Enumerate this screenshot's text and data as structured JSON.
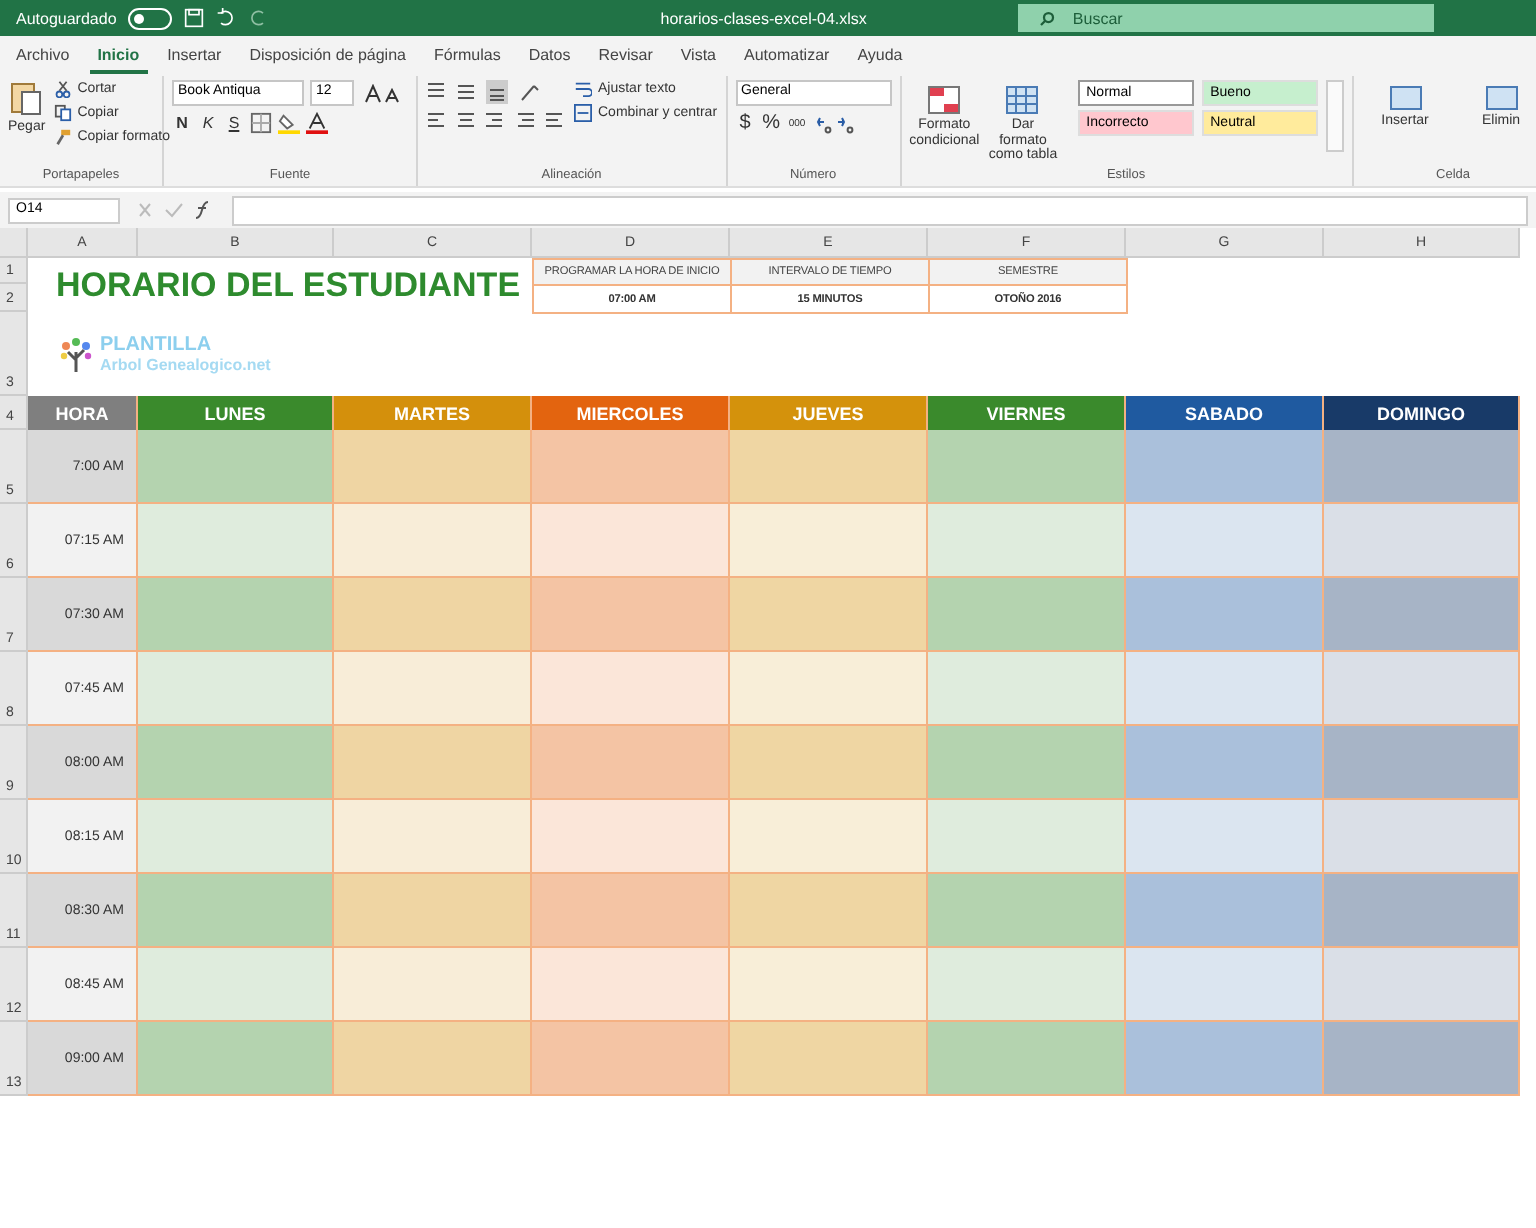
{
  "title_bar": {
    "autosave_label": "Autoguardado",
    "autosave_on": false,
    "filename": "horarios-clases-excel-04.xlsx",
    "search_placeholder": "Buscar"
  },
  "menu_tabs": [
    {
      "label": "Archivo",
      "selected": false
    },
    {
      "label": "Inicio",
      "selected": true
    },
    {
      "label": "Insertar",
      "selected": false
    },
    {
      "label": "Disposición de página",
      "selected": false
    },
    {
      "label": "Fórmulas",
      "selected": false
    },
    {
      "label": "Datos",
      "selected": false
    },
    {
      "label": "Revisar",
      "selected": false
    },
    {
      "label": "Vista",
      "selected": false
    },
    {
      "label": "Automatizar",
      "selected": false
    },
    {
      "label": "Ayuda",
      "selected": false
    }
  ],
  "ribbon": {
    "clipboard": {
      "paste": "Pegar",
      "cut": "Cortar",
      "copy": "Copiar",
      "format_painter": "Copiar formato",
      "label": "Portapapeles"
    },
    "font": {
      "family": "Book Antiqua",
      "size": "12",
      "bold": "N",
      "italic": "K",
      "underline": "S",
      "label": "Fuente"
    },
    "alignment": {
      "wrap": "Ajustar texto",
      "merge": "Combinar y centrar",
      "label": "Alineación"
    },
    "number": {
      "format": "General",
      "currency": "$",
      "percent": "%",
      "thousands": "000",
      "label": "Número"
    },
    "styles": {
      "conditional": "Formato condicional",
      "as_table": "Dar formato como tabla",
      "label": "Estilos",
      "cell_styles": [
        {
          "label": "Normal",
          "color": "#ffffff"
        },
        {
          "label": "Bueno",
          "color": "#c6efce"
        },
        {
          "label": "Incorrecto",
          "color": "#ffc7ce"
        },
        {
          "label": "Neutral",
          "color": "#ffeb9c"
        }
      ]
    },
    "cells": {
      "insert": "Insertar",
      "delete": "Elimin",
      "label": "Celda"
    }
  },
  "name_box": "O14",
  "column_headers": [
    "A",
    "B",
    "C",
    "D",
    "E",
    "F",
    "G",
    "H"
  ],
  "row_numbers": [
    "1",
    "2",
    "3",
    "4",
    "5",
    "6",
    "7",
    "8",
    "9",
    "10",
    "11",
    "12",
    "13"
  ],
  "sheet": {
    "title": "HORARIO DEL ESTUDIANTE",
    "info": [
      {
        "label": "PROGRAMAR LA HORA DE INICIO",
        "value": "07:00 AM"
      },
      {
        "label": "INTERVALO DE TIEMPO",
        "value": "15 MINUTOS"
      },
      {
        "label": "SEMESTRE",
        "value": "OTOÑO 2016"
      }
    ],
    "logo": {
      "line1": "PLANTILLA",
      "line2": "Arbol Genealogico.net"
    },
    "headers": [
      {
        "label": "HORA",
        "color": "#7f7f7f"
      },
      {
        "label": "LUNES",
        "color": "#3a8a2c"
      },
      {
        "label": "MARTES",
        "color": "#d4900c"
      },
      {
        "label": "MIERCOLES",
        "color": "#e3640f"
      },
      {
        "label": "JUEVES",
        "color": "#d4920c"
      },
      {
        "label": "VIERNES",
        "color": "#3a8a2c"
      },
      {
        "label": "SABADO",
        "color": "#1f5aa0"
      },
      {
        "label": "DOMINGO",
        "color": "#183a68"
      }
    ],
    "times": [
      "7:00 AM",
      "07:15 AM",
      "07:30 AM",
      "07:45 AM",
      "08:00 AM",
      "08:15 AM",
      "08:30 AM",
      "08:45 AM",
      "09:00 AM"
    ]
  }
}
